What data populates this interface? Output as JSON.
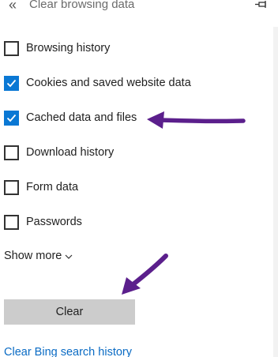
{
  "header": {
    "back_icon": "double-chevron-left-icon",
    "title": "Clear browsing data",
    "pin_icon": "pin-icon"
  },
  "options": [
    {
      "label": "Browsing history",
      "checked": false
    },
    {
      "label": "Cookies and saved website data",
      "checked": true
    },
    {
      "label": "Cached data and files",
      "checked": true
    },
    {
      "label": "Download history",
      "checked": false
    },
    {
      "label": "Form data",
      "checked": false
    },
    {
      "label": "Passwords",
      "checked": false
    }
  ],
  "show_more": {
    "label": "Show more",
    "icon": "chevron-down-icon"
  },
  "clear_button": {
    "label": "Clear"
  },
  "bing_link": {
    "label": "Clear Bing search history"
  },
  "colors": {
    "accent": "#0a78d4",
    "link": "#0a6bc4",
    "button_bg": "#cccccc",
    "annotation_arrow": "#5b1f8c"
  }
}
